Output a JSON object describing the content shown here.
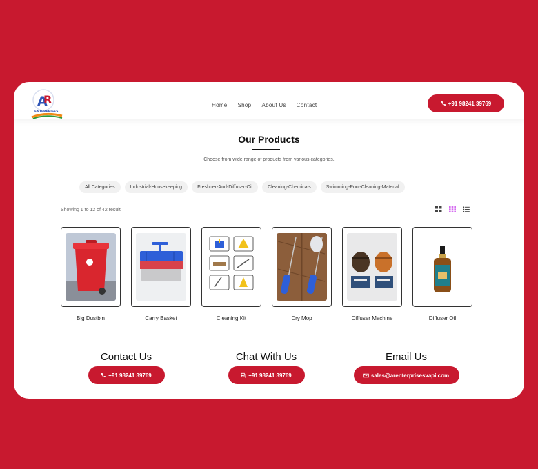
{
  "brand": {
    "logo_text": "ENTERPRISES",
    "logo_letters": "AR"
  },
  "nav": [
    {
      "label": "Home"
    },
    {
      "label": "Shop"
    },
    {
      "label": "About Us"
    },
    {
      "label": "Contact"
    }
  ],
  "header_phone": {
    "label": "+91 98241 39769",
    "icon": "phone-icon"
  },
  "heading": {
    "title": "Our Products",
    "subtitle": "Choose from wide range of products from various categories."
  },
  "categories": [
    {
      "label": "All Categories"
    },
    {
      "label": "Industrial-Housekeeping"
    },
    {
      "label": "Freshner-And-Diffuser-Oil"
    },
    {
      "label": "Cleaning-Chemicals"
    },
    {
      "label": "Swimming-Pool-Cleaning-Material"
    }
  ],
  "results": {
    "text": "Showing 1 to 12 of 42 result"
  },
  "view_options": {
    "active": "grid-large-icon",
    "options": [
      "grid-small-icon",
      "grid-large-icon",
      "list-icon"
    ],
    "active_color": "#d46cf0"
  },
  "products": [
    {
      "name": "Big Dustbin",
      "image": "red wheeled dustbin"
    },
    {
      "name": "Carry Basket",
      "image": "blue carry basket"
    },
    {
      "name": "Cleaning Kit",
      "image": "cleaning kit items"
    },
    {
      "name": "Dry Mop",
      "image": "blue dry mops on wooden floor"
    },
    {
      "name": "Diffuser Machine",
      "image": "wooden diffuser machines"
    },
    {
      "name": "Diffuser Oil",
      "image": "diffuser oil bottle"
    }
  ],
  "contact_section": [
    {
      "title": "Contact Us",
      "button": "+91 98241 39769",
      "icon": "phone-icon"
    },
    {
      "title": "Chat With Us",
      "button": "+91 98241 39769",
      "icon": "chat-icon"
    },
    {
      "title": "Email Us",
      "button": "sales@arenterprisesvapi.com",
      "icon": "mail-icon"
    }
  ],
  "colors": {
    "brand_red": "#c8192f",
    "background": "#c8192f",
    "card": "#ffffff"
  }
}
